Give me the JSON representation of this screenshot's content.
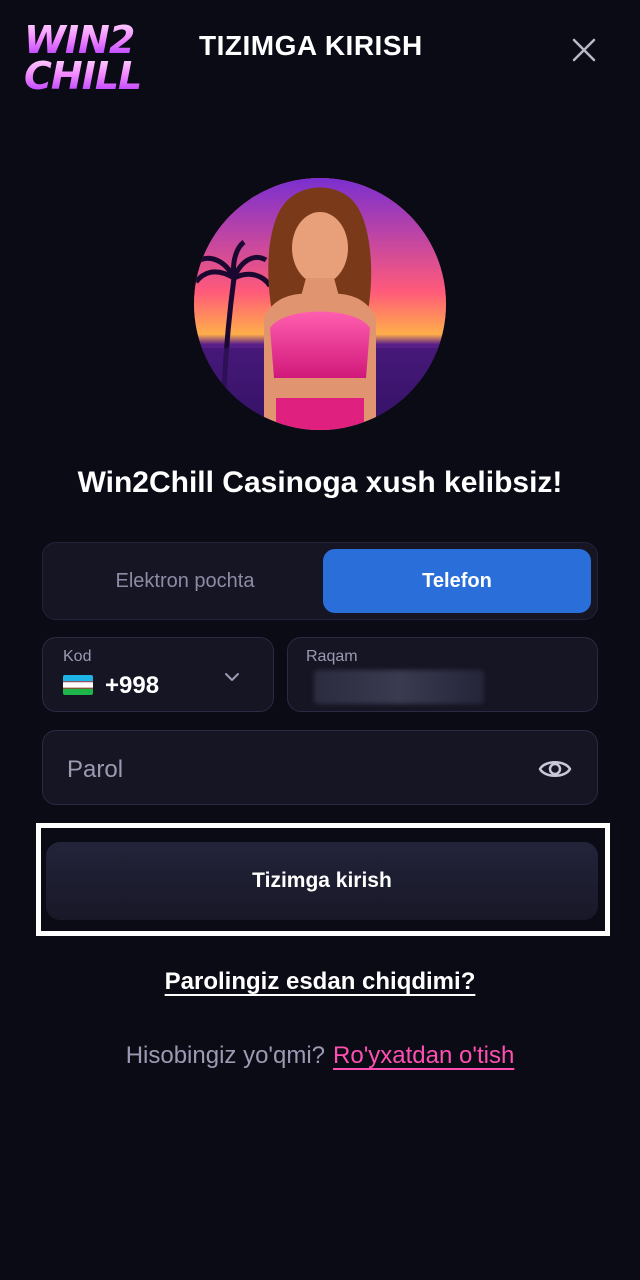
{
  "header": {
    "logo_line1": "WIN2",
    "logo_line2": "CHILL",
    "title": "TIZIMGA KIRISH",
    "close_icon": "close-icon"
  },
  "welcome": {
    "text": "Win2Chill Casinoga xush kelibsiz!"
  },
  "tabs": {
    "items": [
      {
        "label": "Elektron pochta",
        "active": false
      },
      {
        "label": "Telefon",
        "active": true
      }
    ],
    "active_color": "#2a6fd9"
  },
  "form": {
    "code": {
      "label": "Kod",
      "value": "+998",
      "flag_icon": "uzbekistan-flag-icon",
      "dropdown_icon": "chevron-down-icon"
    },
    "number": {
      "label": "Raqam",
      "value": ""
    },
    "password": {
      "placeholder": "Parol",
      "toggle_icon": "eye-icon"
    },
    "submit_label": "Tizimga kirish"
  },
  "links": {
    "forgot_password": "Parolingiz esdan chiqdimi?",
    "register_prompt": "Hisobingiz yo'qmi?",
    "register_link": "Ro'yxatdan o'tish",
    "register_color": "#ff4fb2"
  },
  "colors": {
    "background": "#0b0b16",
    "field_background": "#151524",
    "accent": "#2a6fd9"
  }
}
